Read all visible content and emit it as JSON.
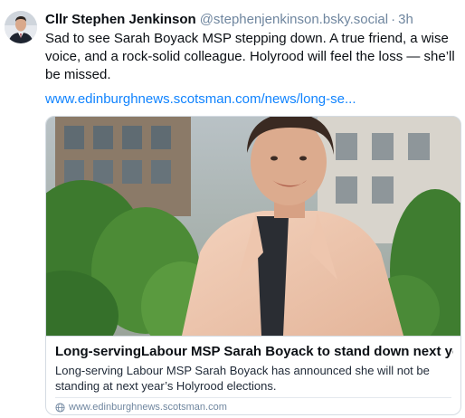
{
  "post": {
    "author": "Cllr Stephen Jenkinson",
    "handle": "@stephenjenkinson.bsky.social",
    "separator": "·",
    "time": "3h",
    "text": "Sad to see Sarah Boyack MSP stepping down. A true friend, a wise voice, and a rock-solid colleague. Holyrood will feel the loss — she’ll be missed.",
    "link_text": "www.edinburghnews.scotsman.com/news/long-se..."
  },
  "card": {
    "title": "Long-servingLabour MSP Sarah Boyack to stand down next year",
    "description": "Long-serving Labour MSP Sarah Boyack has announced she will not be standing at next year’s Holyrood elections.",
    "domain": "www.edinburghnews.scotsman.com",
    "image_icon": "person-photo",
    "domain_icon": "globe-icon"
  },
  "colors": {
    "link": "#1083fe",
    "muted": "#6f869f",
    "text": "#0b0f14",
    "border": "#d4dbe2"
  }
}
